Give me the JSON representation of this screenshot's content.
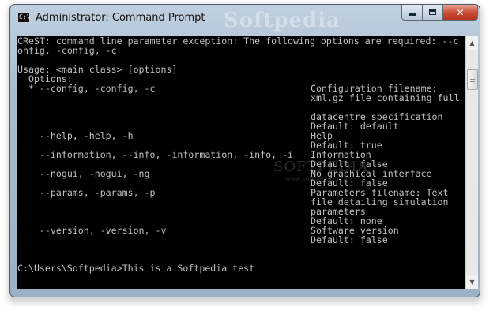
{
  "window": {
    "title": "Administrator: Command Prompt",
    "watermark": "Softpedia",
    "icon": "cmd-icon",
    "controls": {
      "minimize": "minimize-icon",
      "maximize": "maximize-icon",
      "close": "close-icon"
    }
  },
  "console": {
    "watermark": "SOFTPEDIA",
    "watermark_url": "www.softpedia.com",
    "lines": [
      {
        "left": "CReST: command line parameter exception: The following options are required: --c",
        "right": ""
      },
      {
        "left": "onfig, -config, -c",
        "right": ""
      },
      {
        "left": "",
        "right": ""
      },
      {
        "left": "Usage: <main class> [options]",
        "right": ""
      },
      {
        "left": "  Options:",
        "right": ""
      },
      {
        "left": "  * --config, -config, -c",
        "right": "Configuration filename:"
      },
      {
        "left": "",
        "right": "xml.gz file containing full"
      },
      {
        "left": "",
        "right": ""
      },
      {
        "left": "",
        "right": "datacentre specification"
      },
      {
        "left": "",
        "right": "Default: default"
      },
      {
        "left": "    --help, -help, -h",
        "right": "Help"
      },
      {
        "left": "",
        "right": "Default: true"
      },
      {
        "left": "    --information, --info, -information, -info, -i",
        "right": "Information"
      },
      {
        "left": "",
        "right": "Default: false"
      },
      {
        "left": "    --nogui, -nogui, -ng",
        "right": "No graphical interface"
      },
      {
        "left": "",
        "right": "Default: false"
      },
      {
        "left": "    --params, -params, -p",
        "right": "Parameters filename: Text"
      },
      {
        "left": "",
        "right": "file detailing simulation"
      },
      {
        "left": "",
        "right": "parameters"
      },
      {
        "left": "",
        "right": "Default: none"
      },
      {
        "left": "    --version, -version, -v",
        "right": "Software version"
      },
      {
        "left": "",
        "right": "Default: false"
      },
      {
        "left": "",
        "right": ""
      },
      {
        "left": "",
        "right": ""
      },
      {
        "left": "C:\\Users\\Softpedia>This is a Softpedia test",
        "right": ""
      }
    ]
  },
  "scrollbar": {
    "up": "▲",
    "down": "▼"
  }
}
